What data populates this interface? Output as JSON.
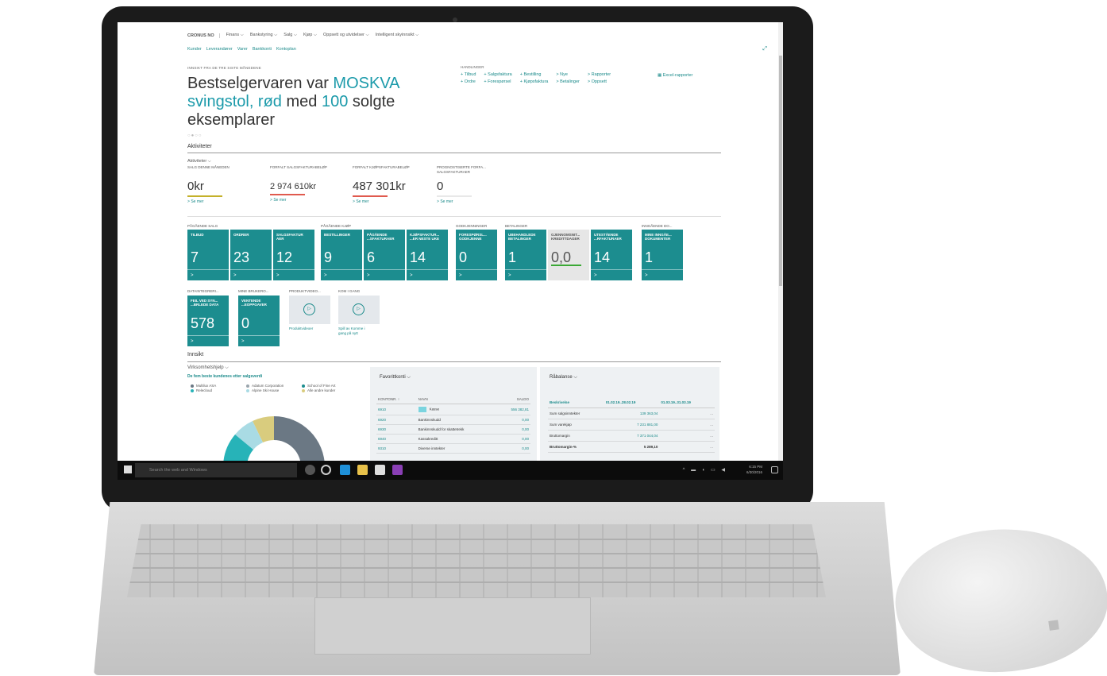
{
  "nav": {
    "brand": "CRONUS NO",
    "menus": [
      "Finans",
      "Bankstyring",
      "Salg",
      "Kjøp",
      "Oppsett og utvidelser",
      "Intelligent skyinnsikt"
    ],
    "links": [
      "Kunder",
      "Leverandører",
      "Varer",
      "Bankkonti",
      "Kontoplan"
    ]
  },
  "headline": {
    "eyebrow": "INNSIKT FRA DE TRE SISTE MÅNEDENE",
    "pre": "Bestselgervaren var ",
    "item": "MOSKVA svingstol, rød",
    "mid": " med ",
    "count": "100",
    "post": " solgte eksemplarer"
  },
  "actions": {
    "title": "HANDLINGER",
    "items": [
      "+ Tilbud",
      "+ Salgsfaktura",
      "+ Bestilling",
      "> Nye",
      "> Rapporter",
      "+ Ordre",
      "+ Forespørsel",
      "+ Kjøpsfaktura",
      "> Betalinger",
      "> Oppsett"
    ],
    "excel": "Excel-rapporter"
  },
  "activities": {
    "section": "Aktiviteter",
    "sub": "Aktiviteter",
    "kpis": [
      {
        "label": "SALG DENNE MÅNEDEN",
        "value": "0kr",
        "more": "Se mer",
        "color": "#c4b12a"
      },
      {
        "label": "FORFALT SALGSFAKTURABELØP",
        "value": "2 974 610kr",
        "more": "Se mer",
        "color": "#e05a4e"
      },
      {
        "label": "FORFALT KJØPSFAKTURABELØP",
        "value": "487 301kr",
        "more": "Se mer",
        "color": "#e05a4e"
      },
      {
        "label": "PROGNOSTISERTE FORFA... SALGSFAKTURAER",
        "value": "0",
        "more": "Se mer",
        "color": "#e8e8e8"
      }
    ],
    "groups": [
      "PÅGÅENDE SALG",
      "PÅGÅENDE KJØP",
      "GODKJENNINGER",
      "BETALINGER",
      "INNGÅENDE DO..."
    ],
    "tiles": [
      {
        "label": "TILBUD",
        "value": "7"
      },
      {
        "label": "ORDRER",
        "value": "23"
      },
      {
        "label": "SALGSFAKTUR AER",
        "value": "12"
      },
      {
        "label": "BESTILLINGER",
        "value": "9"
      },
      {
        "label": "PÅGÅENDE ...SFAKTURAER",
        "value": "6"
      },
      {
        "label": "KJØPSFAKTUR... ...ER NESTE UKE",
        "value": "14"
      },
      {
        "label": "FORESPØRSL... GODKJENNE",
        "value": "0"
      },
      {
        "label": "UBEHANDLEDE BETALINGER",
        "value": "1"
      },
      {
        "label": "GJENNOMSNIT... KREDITTDAGER",
        "value": "0,0"
      },
      {
        "label": "UTESTÅENDE ...RFAKTURAER",
        "value": "14"
      },
      {
        "label": "MINE INNGÅE... DOKUMENTER",
        "value": "1"
      }
    ],
    "groups2": [
      "DATAINTEGRERI...",
      "MINE BRUKERO...",
      "PRODUKTVIDEO...",
      "KOM I GANG"
    ],
    "tiles2": [
      {
        "label": "FEIL VED SYN... ...BRLEDE DATA",
        "value": "578"
      },
      {
        "label": "VENTENDE ...EOPPGAVER",
        "value": "0"
      }
    ],
    "play": [
      "Produktvideoer",
      "Spill av Komme i gang på nytt"
    ],
    "arrow": ">"
  },
  "insight": {
    "section": "Innsikt",
    "chart_title": "Virksomhetshjelp",
    "chart_sub": "De fem beste kundenes etter salgsverdi",
    "legend": [
      {
        "name": "Multilux ASA",
        "color": "#6b7884"
      },
      {
        "name": "Adatum Corporation",
        "color": "#9aa5ad"
      },
      {
        "name": "School of Fine Art",
        "color": "#1c8d8f"
      },
      {
        "name": "Relecloud",
        "color": "#27b3b8"
      },
      {
        "name": "Alpine Ski House",
        "color": "#a9dbe4"
      },
      {
        "name": "Alle andre kunder",
        "color": "#d9cc7e"
      }
    ],
    "favorites": {
      "title": "Favorittkonti",
      "headers": [
        "KONTONR. ↑",
        "NAVN",
        "SALDO"
      ],
      "rows": [
        [
          "6910",
          "Kasse",
          "556 382,81"
        ],
        [
          "6920",
          "Bankinnskudd",
          "0,00"
        ],
        [
          "6930",
          "Bankinnskudd for skattetrekk",
          "0,00"
        ],
        [
          "6940",
          "Kassakreditt",
          "0,00"
        ],
        [
          "9310",
          "Diverse inntekter",
          "0,00"
        ]
      ]
    },
    "trial": {
      "title": "Råbalanse",
      "headers": [
        "Beskrivelse",
        "01.02.19..28.02.19",
        "01.03.19..31.03.19"
      ],
      "rows": [
        [
          "Sum salgsinntekter",
          "139 363,04",
          "..."
        ],
        [
          "Sum varekjøp",
          "7 231 881,00",
          "..."
        ],
        [
          "Bruttomargin",
          "7 371 044,04",
          "..."
        ],
        [
          "Bruttomargin-%",
          "5 289,10",
          "..."
        ]
      ]
    }
  },
  "taskbar": {
    "search": "Search the web and Windows",
    "time": "6:15 PM",
    "date": "6/30/2016"
  }
}
